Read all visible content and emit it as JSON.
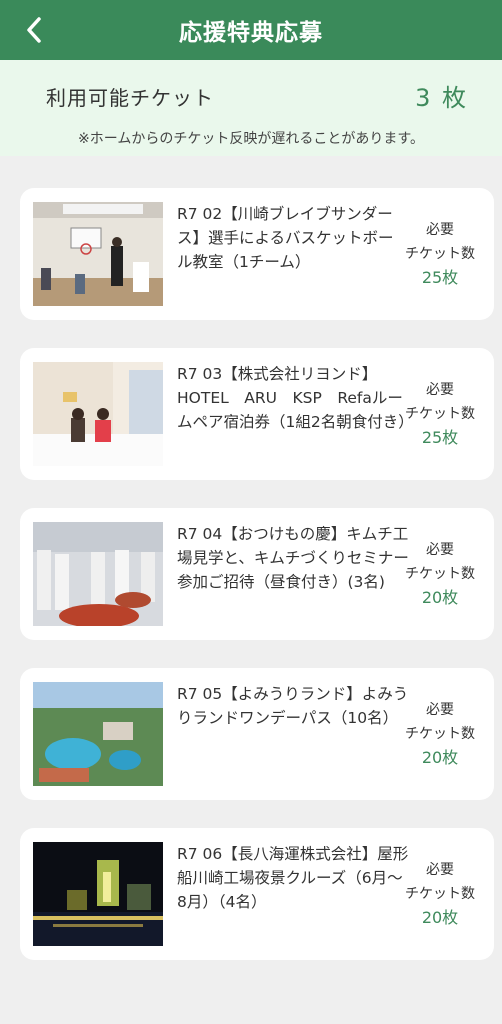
{
  "header": {
    "title": "応援特典応募"
  },
  "ticket": {
    "label": "利用可能チケット",
    "count": "3 枚",
    "note": "※ホームからのチケット反映が遅れることがあります。"
  },
  "items": [
    {
      "title": "R7 02【川崎ブレイブサンダース】選手によるバスケットボール教室（1チーム）",
      "req1": "必要",
      "req2": "チケット数",
      "req_count": "25枚"
    },
    {
      "title": "R7 03【株式会社リヨンド】HOTEL　ARU　KSP　Refaルームペア宿泊券（1組2名朝食付き）",
      "req1": "必要",
      "req2": "チケット数",
      "req_count": "25枚"
    },
    {
      "title": "R7 04【おつけもの慶】キムチ工場見学と、キムチづくりセミナー参加ご招待（昼食付き）(3名)",
      "req1": "必要",
      "req2": "チケット数",
      "req_count": "20枚"
    },
    {
      "title": "R7 05【よみうりランド】よみうりランドワンデーパス（10名）",
      "req1": "必要",
      "req2": "チケット数",
      "req_count": "20枚"
    },
    {
      "title": "R7 06【長八海運株式会社】屋形船川崎工場夜景クルーズ（6月〜8月）（4名）",
      "req1": "必要",
      "req2": "チケット数",
      "req_count": "20枚"
    }
  ],
  "colors": {
    "header": "#3a8a5a",
    "accent": "#3f8a5c",
    "ticket_bg": "#eaf8ec"
  },
  "icons": {
    "back": "chevron-left-icon"
  }
}
